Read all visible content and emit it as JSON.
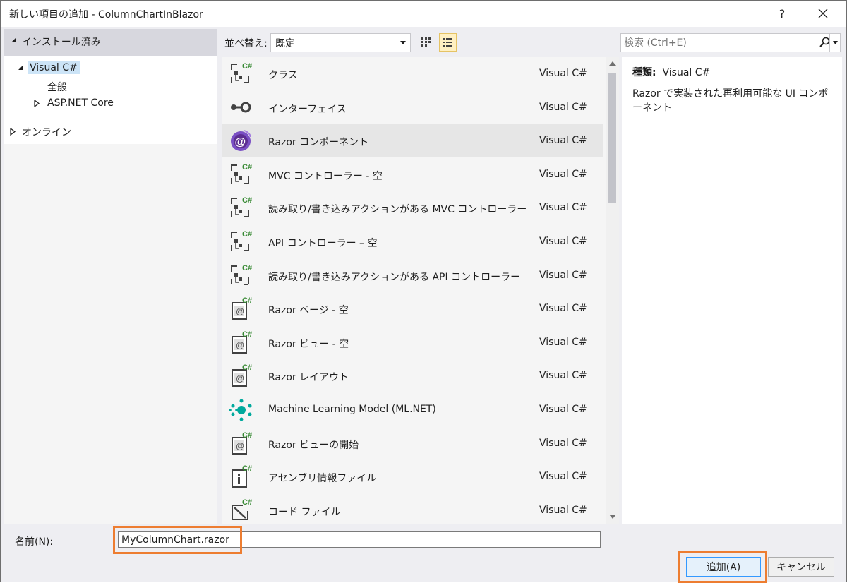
{
  "window": {
    "title": "新しい項目の追加 - ColumnChartInBlazor",
    "help": "?"
  },
  "sidebar": {
    "header": "インストール済み",
    "items": [
      {
        "label": "Visual C#"
      },
      {
        "label": "全般"
      },
      {
        "label": "ASP.NET Core"
      },
      {
        "label": "オンライン"
      }
    ]
  },
  "toolbar": {
    "sort_label": "並べ替え:",
    "sort_value": "既定"
  },
  "search": {
    "placeholder": "検索 (Ctrl+E)"
  },
  "templates": [
    {
      "name": "クラス",
      "lang": "Visual C#",
      "icon": "csharp-class-icon"
    },
    {
      "name": "インターフェイス",
      "lang": "Visual C#",
      "icon": "interface-icon"
    },
    {
      "name": "Razor コンポーネント",
      "lang": "Visual C#",
      "icon": "blazor-icon",
      "selected": true
    },
    {
      "name": "MVC コントローラー - 空",
      "lang": "Visual C#",
      "icon": "csharp-class-icon"
    },
    {
      "name": "読み取り/書き込みアクションがある MVC コントローラー",
      "lang": "Visual C#",
      "icon": "csharp-class-icon"
    },
    {
      "name": "API コントローラー – 空",
      "lang": "Visual C#",
      "icon": "csharp-class-icon"
    },
    {
      "name": "読み取り/書き込みアクションがある API コントローラー",
      "lang": "Visual C#",
      "icon": "csharp-class-icon"
    },
    {
      "name": "Razor ページ - 空",
      "lang": "Visual C#",
      "icon": "razor-page-icon"
    },
    {
      "name": "Razor ビュー - 空",
      "lang": "Visual C#",
      "icon": "razor-page-icon"
    },
    {
      "name": "Razor レイアウト",
      "lang": "Visual C#",
      "icon": "razor-page-icon"
    },
    {
      "name": "Machine Learning Model (ML.NET)",
      "lang": "Visual C#",
      "icon": "ml-net-icon"
    },
    {
      "name": "Razor ビューの開始",
      "lang": "Visual C#",
      "icon": "razor-page-icon"
    },
    {
      "name": "アセンブリ情報ファイル",
      "lang": "Visual C#",
      "icon": "assembly-info-icon"
    },
    {
      "name": "コード ファイル",
      "lang": "Visual C#",
      "icon": "code-file-icon"
    }
  ],
  "details": {
    "type_label": "種類:",
    "type_value": "Visual C#",
    "description": "Razor で実装された再利用可能な UI コンポーネント"
  },
  "footer": {
    "name_label": "名前(N):",
    "name_value": "MyColumnChart.razor",
    "add_button": "追加(A)",
    "cancel_button": "キャンセル"
  },
  "colors": {
    "highlight": "#ed7d31",
    "selected_row": "#e6e6e6",
    "blazor": "#5c2d91",
    "csharp_badge": "#388a34",
    "ml": "#00a99d"
  }
}
